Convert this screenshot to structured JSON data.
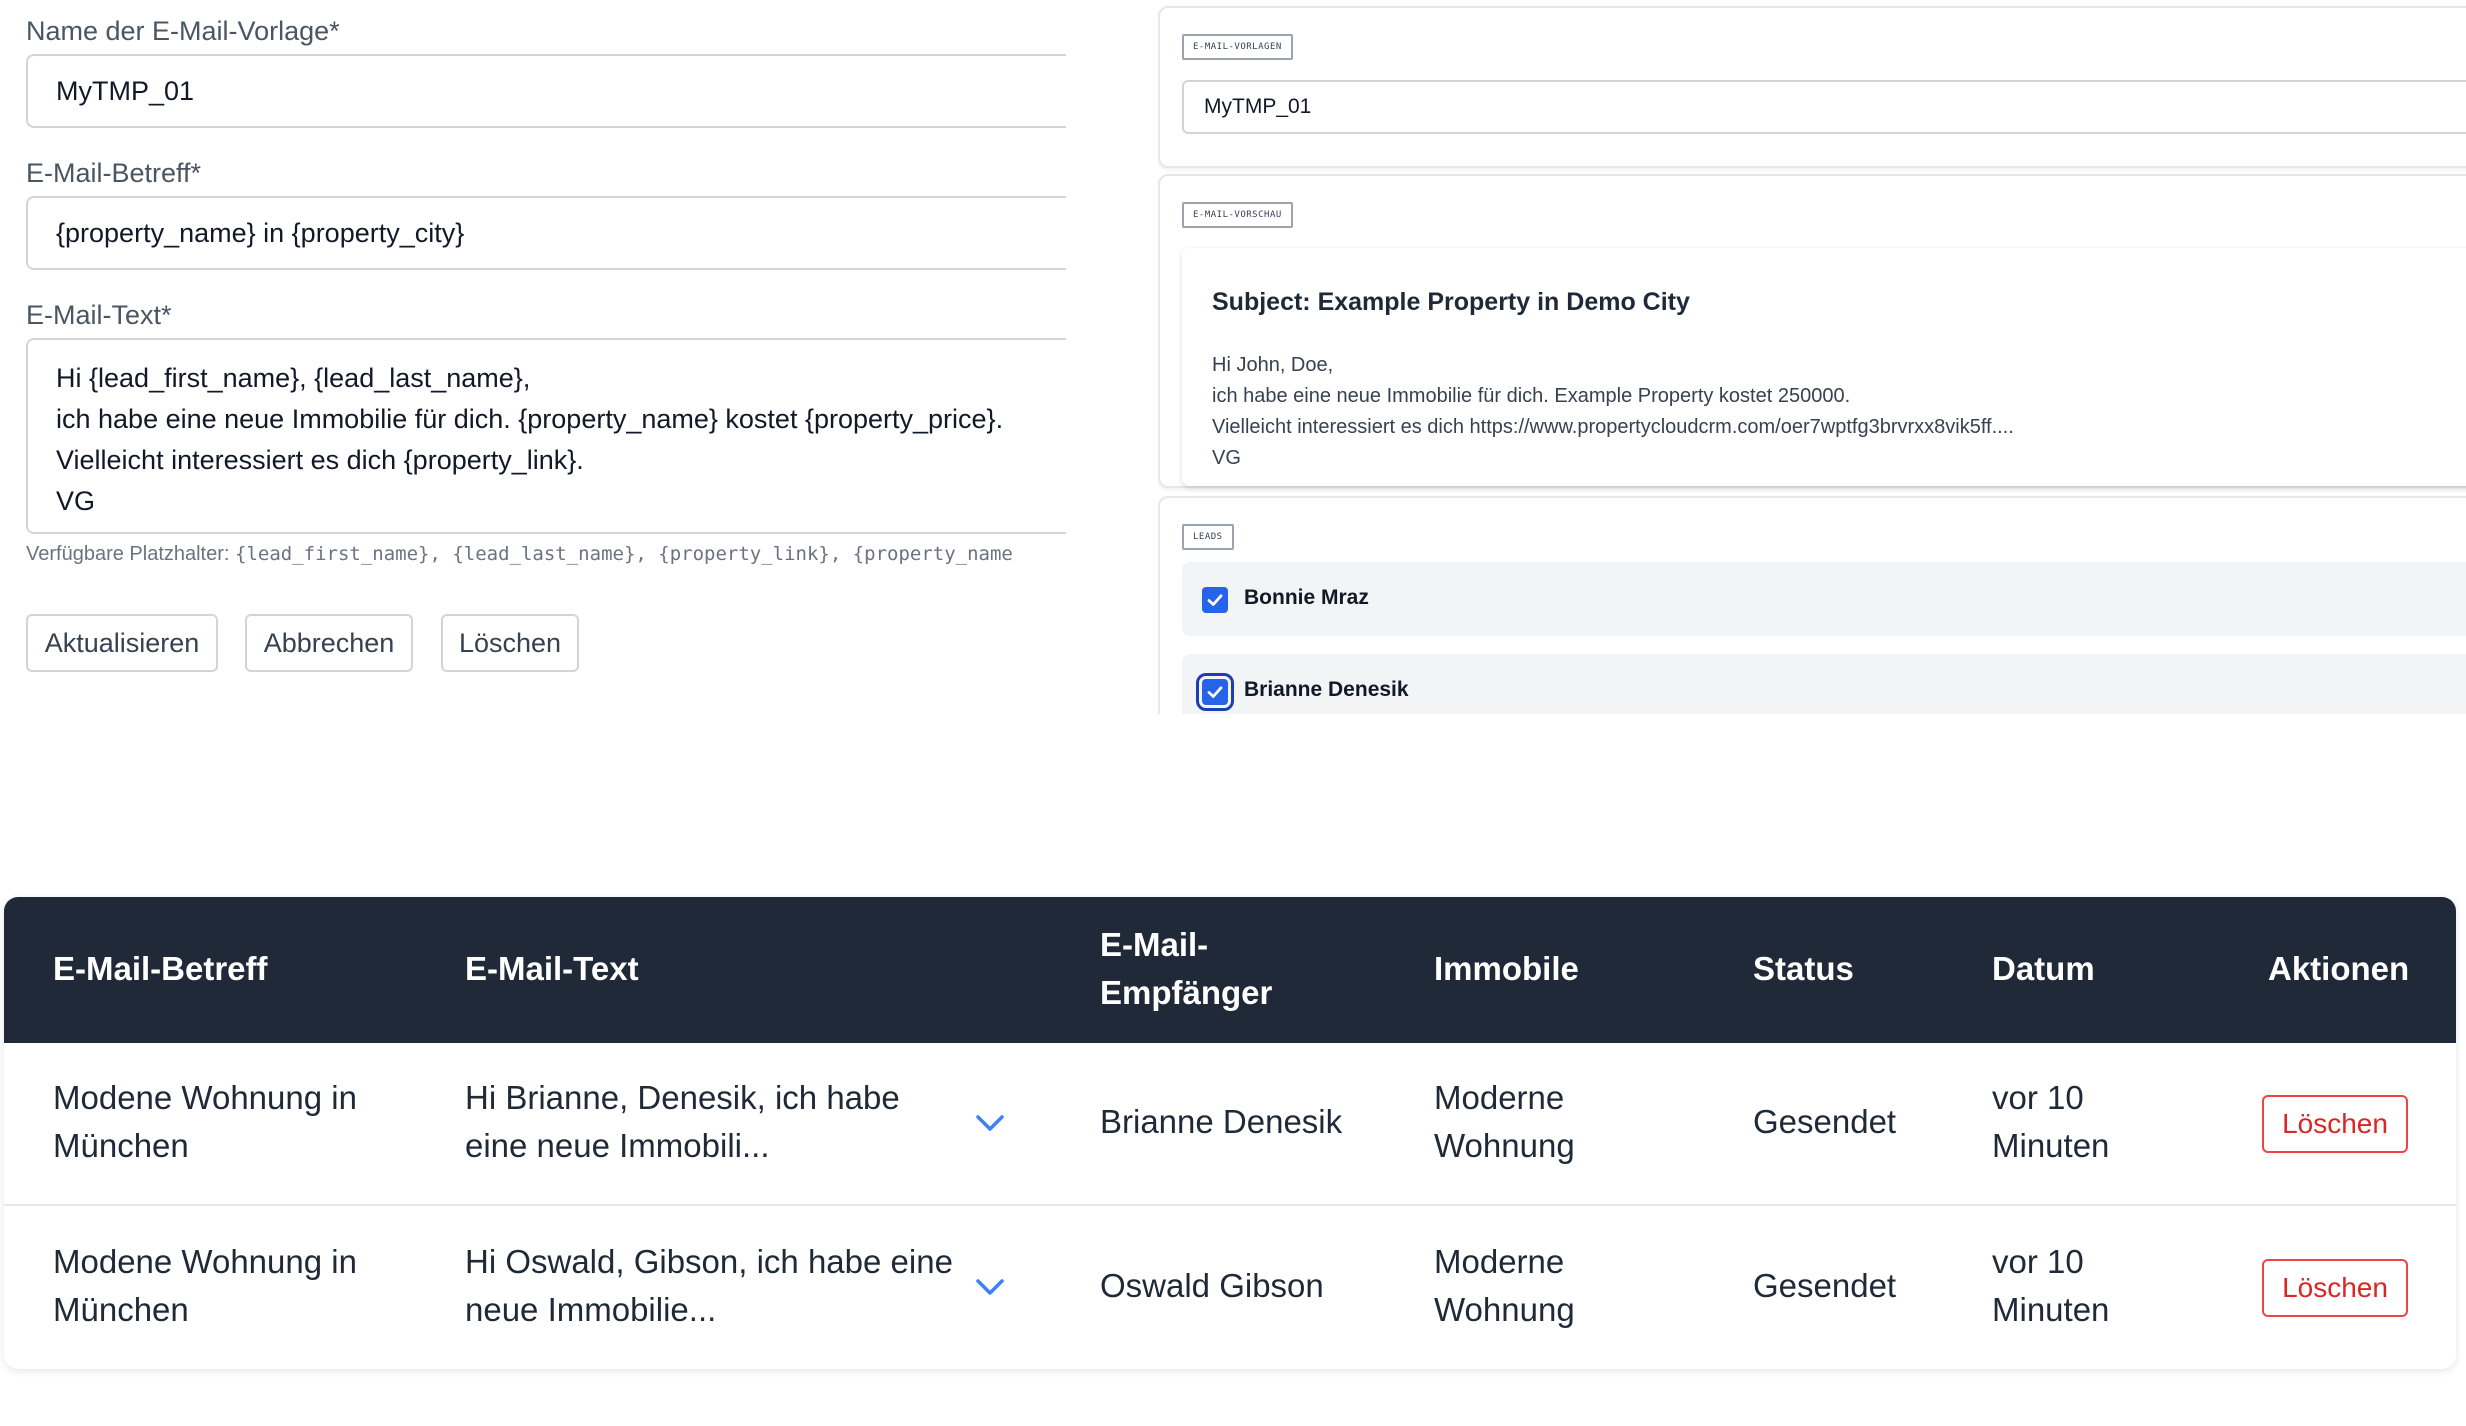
{
  "form": {
    "name_label": "Name der E-Mail-Vorlage*",
    "name_value": "MyTMP_01",
    "subject_label": "E-Mail-Betreff*",
    "subject_value": "{property_name} in {property_city}",
    "text_label": "E-Mail-Text*",
    "text_lines": [
      "Hi {lead_first_name}, {lead_last_name},",
      "ich habe eine neue Immobilie für dich. {property_name} kostet {property_price}.",
      "Vielleicht interessiert es dich {property_link}.",
      "VG"
    ],
    "hint_prefix": "Verfügbare Platzhalter: ",
    "hint_placeholders": "{lead_first_name}, {lead_last_name}, {property_link}, {property_name",
    "buttons": {
      "update": "Aktualisieren",
      "cancel": "Abbrechen",
      "delete": "Löschen"
    }
  },
  "templates_panel": {
    "tag": "E-MAIL-VORLAGEN",
    "selected": "MyTMP_01"
  },
  "preview_panel": {
    "tag": "E-MAIL-VORSCHAU",
    "subject": "Subject: Example Property in Demo City",
    "lines": [
      "Hi John, Doe,",
      "ich habe eine neue Immobilie für dich. Example Property kostet 250000.",
      "Vielleicht interessiert es dich https://www.propertycloudcrm.com/oer7wptfg3brvrxx8vik5ff....",
      "VG"
    ]
  },
  "leads_panel": {
    "tag": "LEADS",
    "leads": [
      {
        "name": "Bonnie Mraz",
        "checked": true
      },
      {
        "name": "Brianne Denesik",
        "checked": true
      }
    ]
  },
  "table": {
    "headers": {
      "subject": "E-Mail-Betreff",
      "text": "E-Mail-Text",
      "recipient_1": "E-Mail-",
      "recipient_2": "Empfänger",
      "property": "Immobile",
      "status": "Status",
      "date": "Datum",
      "actions": "Aktionen"
    },
    "rows": [
      {
        "subject_1": "Modene Wohnung in",
        "subject_2": "München",
        "text_1": "Hi Brianne, Denesik, ich habe",
        "text_2": "eine neue Immobili...",
        "recipient": "Brianne Denesik",
        "property_1": "Moderne",
        "property_2": "Wohnung",
        "status": "Gesendet",
        "date_1": "vor 10",
        "date_2": "Minuten",
        "action": "Löschen"
      },
      {
        "subject_1": "Modene Wohnung in",
        "subject_2": "München",
        "text_1": "Hi Oswald, Gibson, ich habe eine",
        "text_2": "neue Immobilie...",
        "recipient": "Oswald Gibson",
        "property_1": "Moderne",
        "property_2": "Wohnung",
        "status": "Gesendet",
        "date_1": "vor 10",
        "date_2": "Minuten",
        "action": "Löschen"
      }
    ]
  },
  "colors": {
    "table_header_bg": "#1f2937",
    "checkbox_accent": "#2563eb",
    "danger": "#ef4444"
  }
}
